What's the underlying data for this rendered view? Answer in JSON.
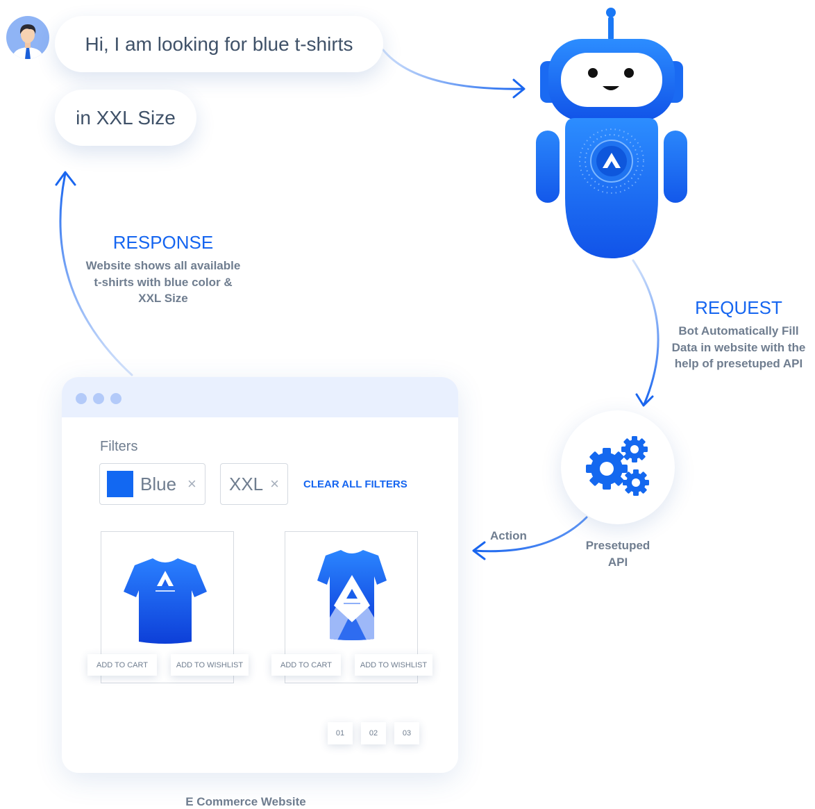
{
  "user_message_1": "Hi, I am looking for blue t-shirts",
  "user_message_2": "in XXL Size",
  "response": {
    "title": "RESPONSE",
    "lines": [
      "Website shows all available",
      "t-shirts with blue color &",
      "XXL Size"
    ]
  },
  "request": {
    "title": "REQUEST",
    "lines": [
      "Bot Automatically Fill",
      "Data in website with the",
      "help of presetuped API"
    ]
  },
  "website": {
    "filters_label": "Filters",
    "chips": [
      {
        "label": "Blue",
        "remove": "×",
        "swatch_color": "#1268f2"
      },
      {
        "label": "XXL",
        "remove": "×"
      }
    ],
    "clear_all": "CLEAR ALL FILTERS",
    "products": [
      {
        "add_to_cart": "ADD TO CART",
        "add_to_wishlist": "ADD TO WISHLIST"
      },
      {
        "add_to_cart": "ADD TO CART",
        "add_to_wishlist": "ADD TO WISHLIST"
      }
    ],
    "pages": [
      "01",
      "02",
      "03"
    ],
    "caption": "E Commerce Website"
  },
  "action_label": "Action",
  "api_label_lines": [
    "Presetuped",
    "API"
  ],
  "colors": {
    "accent": "#1565f0",
    "text_gray": "#6f7d8f",
    "bubble_text": "#3f5168",
    "browser_bar": "#e9f0fe"
  },
  "icons": [
    "user-avatar-icon",
    "chatbot-robot-icon",
    "gears-icon",
    "brand-logo-icon",
    "arrow-icon"
  ]
}
